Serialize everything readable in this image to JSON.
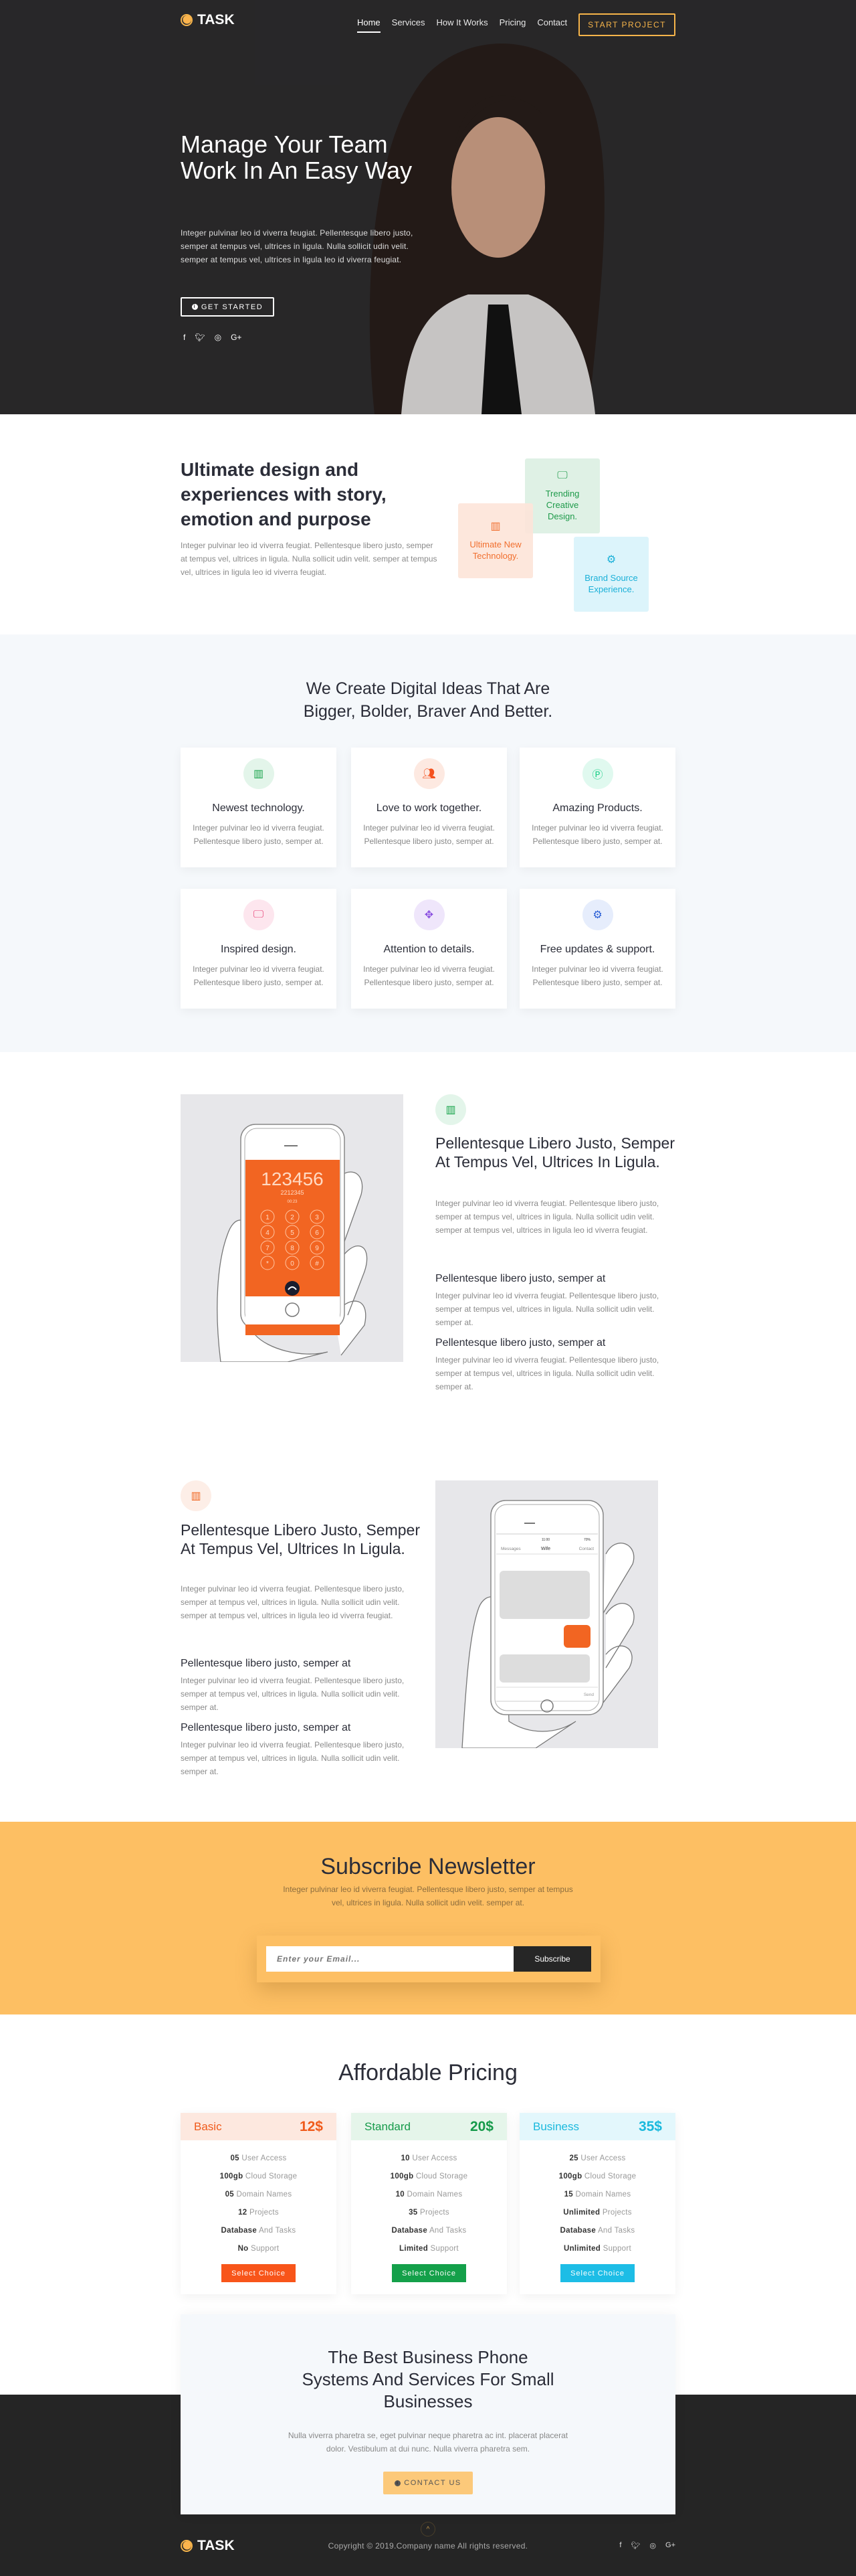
{
  "brand": {
    "name": "TASK",
    "accent": "#f6b44a"
  },
  "nav": {
    "items": [
      "Home",
      "Services",
      "How It Works",
      "Pricing",
      "Contact"
    ],
    "active": "Home",
    "cta": "START PROJECT"
  },
  "hero": {
    "title": "Manage Your Team Work In An Easy Way",
    "text": "Integer pulvinar leo id viverra feugiat. Pellentesque libero justo, semper at tempus vel, ultrices in ligula. Nulla sollicit udin velit. semper at tempus vel, ultrices in ligula leo id viverra feugiat.",
    "button": "GET STARTED",
    "socials": [
      "facebook-icon",
      "twitter-icon",
      "dribbble-icon",
      "google-plus-icon"
    ]
  },
  "about": {
    "title": "Ultimate design and experiences with story, emotion and purpose",
    "text": "Integer pulvinar leo id viverra feugiat. Pellentesque libero justo, semper at tempus vel, ultrices in ligula. Nulla sollicit udin velit. semper at tempus vel, ultrices in ligula leo id viverra feugiat.",
    "tiles": [
      {
        "label": "Ultimate New Technology.",
        "icon": "building-icon",
        "color": "#f0641e",
        "bg": "#fde5da"
      },
      {
        "label": "Trending Creative Design.",
        "icon": "monitor-icon",
        "color": "#1e9a4a",
        "bg": "#dff1e5"
      },
      {
        "label": "Brand Source Experience.",
        "icon": "cogs-icon",
        "color": "#1ab0d8",
        "bg": "#dcf4fb"
      }
    ]
  },
  "features": {
    "title_line1": "We Create Digital Ideas That Are",
    "title_line2": "Bigger, Bolder, Braver And Better.",
    "items": [
      {
        "title": "Newest technology.",
        "text": "Integer pulvinar leo id viverra feugiat. Pellentesque libero justo, semper at.",
        "icon": "building-icon",
        "color": "#17a34a",
        "bg": "#e3f5ea"
      },
      {
        "title": "Love to work together.",
        "text": "Integer pulvinar leo id viverra feugiat. Pellentesque libero justo, semper at.",
        "icon": "users-icon",
        "color": "#f4511e",
        "bg": "#fde9e1"
      },
      {
        "title": "Amazing Products.",
        "text": "Integer pulvinar leo id viverra feugiat. Pellentesque libero justo, semper at.",
        "icon": "product-hunt-icon",
        "color": "#1fd08a",
        "bg": "#e0f9ef"
      },
      {
        "title": "Inspired design.",
        "text": "Integer pulvinar leo id viverra feugiat. Pellentesque libero justo, semper at.",
        "icon": "monitor-icon",
        "color": "#e8457a",
        "bg": "#fde6ee"
      },
      {
        "title": "Attention to details.",
        "text": "Integer pulvinar leo id viverra feugiat. Pellentesque libero justo, semper at.",
        "icon": "arrows-icon",
        "color": "#8a4fe0",
        "bg": "#efe6fb"
      },
      {
        "title": "Free updates & support.",
        "text": "Integer pulvinar leo id viverra feugiat. Pellentesque libero justo, semper at.",
        "icon": "cogs-icon",
        "color": "#2a5fd6",
        "bg": "#e6edfc"
      }
    ]
  },
  "split1": {
    "icon": "building-icon",
    "icon_color": "#17a34a",
    "icon_bg": "#e3f5ea",
    "title": "Pellentesque Libero Justo, Semper At Tempus Vel, Ultrices In Ligula.",
    "text": "Integer pulvinar leo id viverra feugiat. Pellentesque libero justo, semper at tempus vel, ultrices in ligula. Nulla sollicit udin velit. semper at tempus vel, ultrices in ligula leo id viverra feugiat.",
    "sub1": "Pellentesque libero justo, semper at",
    "sub1_text": "Integer pulvinar leo id viverra feugiat. Pellentesque libero justo, semper at tempus vel, ultrices in ligula. Nulla sollicit udin velit. semper at.",
    "sub2": "Pellentesque libero justo, semper at",
    "sub2_text": "Integer pulvinar leo id viverra feugiat. Pellentesque libero justo, semper at tempus vel, ultrices in ligula. Nulla sollicit udin velit. semper at.",
    "phone": {
      "number": "123456",
      "sub": "2212345",
      "timer": "00:23",
      "keys": [
        "1",
        "2",
        "3",
        "4",
        "5",
        "6",
        "7",
        "8",
        "9",
        "*",
        "0",
        "#"
      ]
    }
  },
  "split2": {
    "icon": "building-icon",
    "icon_color": "#f0641e",
    "icon_bg": "#fdeee7",
    "title": "Pellentesque Libero Justo, Semper At Tempus Vel, Ultrices In Ligula.",
    "text": "Integer pulvinar leo id viverra feugiat. Pellentesque libero justo, semper at tempus vel, ultrices in ligula. Nulla sollicit udin velit. semper at tempus vel, ultrices in ligula leo id viverra feugiat.",
    "sub1": "Pellentesque libero justo, semper at",
    "sub1_text": "Integer pulvinar leo id viverra feugiat. Pellentesque libero justo, semper at tempus vel, ultrices in ligula. Nulla sollicit udin velit. semper at.",
    "sub2": "Pellentesque libero justo, semper at",
    "sub2_text": "Integer pulvinar leo id viverra feugiat. Pellentesque libero justo, semper at tempus vel, ultrices in ligula. Nulla sollicit udin velit. semper at.",
    "phone": {
      "time": "11:00",
      "battery": "70%",
      "back": "Messages",
      "contact_name": "Wife",
      "contact": "Contact",
      "send": "Send"
    }
  },
  "newsletter": {
    "title": "Subscribe Newsletter",
    "text": "Integer pulvinar leo id viverra feugiat. Pellentesque libero justo, semper at tempus vel, ultrices in ligula. Nulla sollicit udin velit. semper at.",
    "placeholder": "Enter your Email...",
    "button": "Subscribe",
    "bg": "#fdbf63"
  },
  "pricing": {
    "title": "Affordable Pricing",
    "plans": [
      {
        "name": "Basic",
        "price": "12$",
        "color": "#f05a1a",
        "head_bg": "#fde8df",
        "btn": "#f8551a",
        "button": "Select Choice",
        "features": [
          [
            "05",
            "User Access"
          ],
          [
            "100gb",
            "Cloud Storage"
          ],
          [
            "05",
            "Domain Names"
          ],
          [
            "12",
            "Projects"
          ],
          [
            "Database",
            "And Tasks"
          ],
          [
            "No",
            "Support"
          ]
        ]
      },
      {
        "name": "Standard",
        "price": "20$",
        "color": "#159a4a",
        "head_bg": "#e5f5ea",
        "btn": "#14a04a",
        "button": "Select Choice",
        "features": [
          [
            "10",
            "User Access"
          ],
          [
            "100gb",
            "Cloud Storage"
          ],
          [
            "10",
            "Domain Names"
          ],
          [
            "35",
            "Projects"
          ],
          [
            "Database",
            "And Tasks"
          ],
          [
            "Limited",
            "Support"
          ]
        ]
      },
      {
        "name": "Business",
        "price": "35$",
        "color": "#1ab9dd",
        "head_bg": "#e3f7fc",
        "btn": "#1dbde6",
        "button": "Select Choice",
        "features": [
          [
            "25",
            "User Access"
          ],
          [
            "100gb",
            "Cloud Storage"
          ],
          [
            "15",
            "Domain Names"
          ],
          [
            "Unlimited",
            "Projects"
          ],
          [
            "Database",
            "And Tasks"
          ],
          [
            "Unlimited",
            "Support"
          ]
        ]
      }
    ]
  },
  "cta": {
    "title": "The Best Business Phone Systems And Services For Small Businesses",
    "text": "Nulla viverra pharetra se, eget pulvinar neque pharetra ac int. placerat placerat dolor. Vestibulum at dui nunc. Nulla viverra pharetra sem.",
    "button": "CONTACT US"
  },
  "footer": {
    "copyright": "Copyright © 2019.Company name All rights reserved.",
    "socials": [
      "facebook-icon",
      "twitter-icon",
      "dribbble-icon",
      "google-plus-icon"
    ]
  }
}
